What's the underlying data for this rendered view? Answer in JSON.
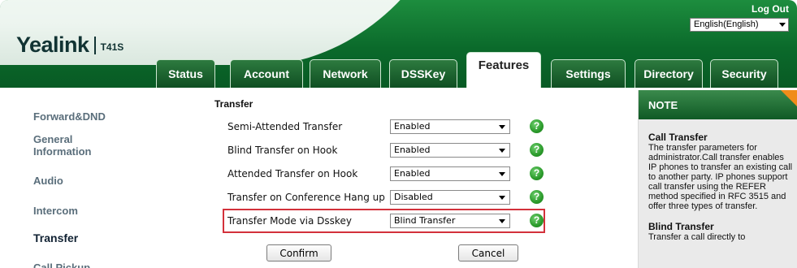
{
  "header": {
    "brand": "Yealink",
    "model": "T41S",
    "logout": "Log Out",
    "language": "English(English)"
  },
  "tabs": [
    {
      "label": "Status"
    },
    {
      "label": "Account"
    },
    {
      "label": "Network"
    },
    {
      "label": "DSSKey"
    },
    {
      "label": "Features",
      "active": true
    },
    {
      "label": "Settings"
    },
    {
      "label": "Directory"
    },
    {
      "label": "Security"
    }
  ],
  "sidebar": {
    "items": [
      {
        "label": "Forward&DND"
      },
      {
        "label": "General\nInformation"
      },
      {
        "label": "Audio"
      },
      {
        "label": "Intercom"
      },
      {
        "label": "Transfer",
        "active": true
      },
      {
        "label": "Call Pickup"
      }
    ]
  },
  "main": {
    "section_title": "Transfer",
    "rows": [
      {
        "label": "Semi-Attended Transfer",
        "value": "Enabled"
      },
      {
        "label": "Blind Transfer on Hook",
        "value": "Enabled"
      },
      {
        "label": "Attended Transfer on Hook",
        "value": "Enabled"
      },
      {
        "label": "Transfer on Conference Hang up",
        "value": "Disabled"
      },
      {
        "label": "Transfer Mode via Dsskey",
        "value": "Blind Transfer"
      }
    ],
    "help_glyph": "?",
    "confirm_label": "Confirm",
    "cancel_label": "Cancel"
  },
  "note": {
    "heading": "NOTE",
    "call_transfer_title": "Call Transfer",
    "call_transfer_text": "The transfer parameters for administrator.Call transfer enables IP phones to transfer an existing call to another party. IP phones support call transfer using the REFER method specified in RFC 3515 and offer three types of transfer.",
    "blind_transfer_title": "Blind Transfer",
    "blind_transfer_text": "Transfer a call directly to"
  },
  "colors": {
    "brand_green": "#0b6a2b",
    "highlight_red": "#d3313b",
    "note_corner": "#f08c1a"
  }
}
